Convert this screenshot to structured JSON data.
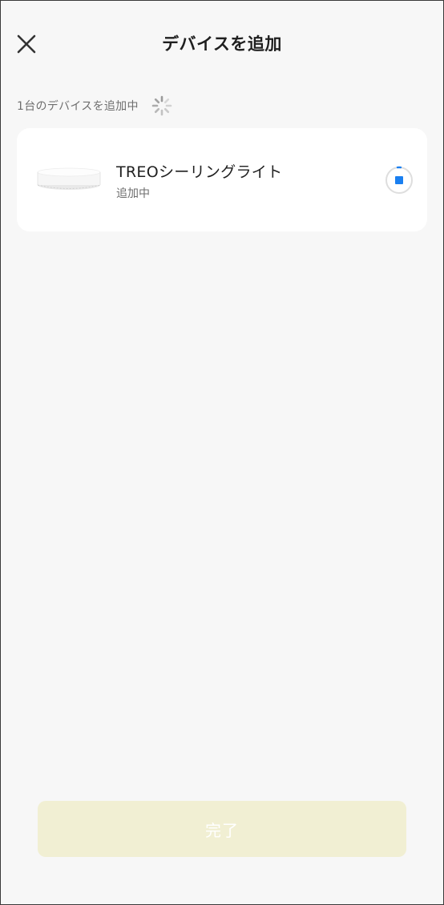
{
  "header": {
    "title": "デバイスを追加",
    "close_icon": "close-icon"
  },
  "status": {
    "text": "1台のデバイスを追加中",
    "spinner_icon": "loading-spinner-icon"
  },
  "devices": [
    {
      "name": "TREOシーリングライト",
      "status": "追加中",
      "image_icon": "ceiling-light-icon",
      "action_icon": "stop-icon"
    }
  ],
  "footer": {
    "done_label": "完了"
  },
  "colors": {
    "background": "#f7f7f7",
    "card": "#ffffff",
    "accent_blue": "#1a7ff0",
    "done_button": "#f1efd3",
    "text_primary": "#1f1f1f",
    "text_secondary": "#6e6e6e"
  }
}
